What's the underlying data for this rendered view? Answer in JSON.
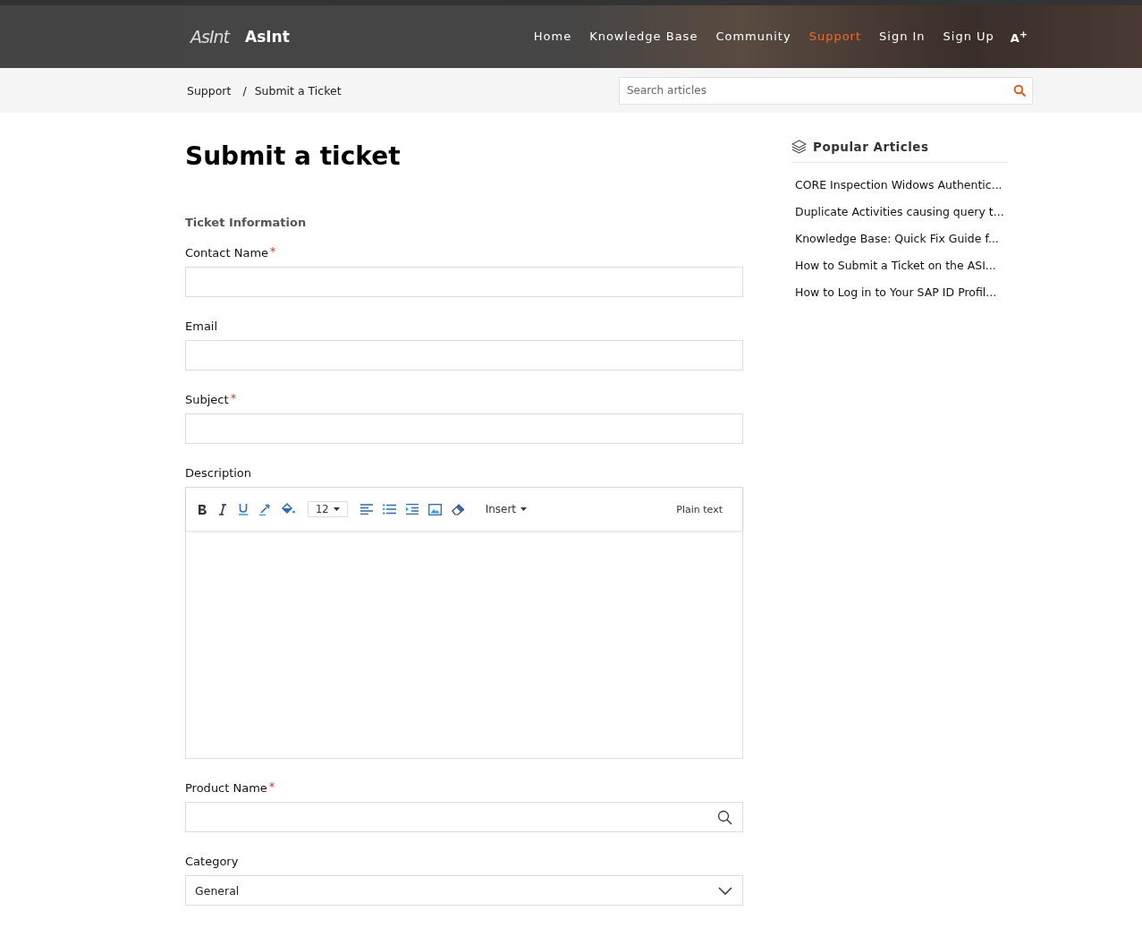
{
  "header": {
    "logo_mark": "AsInt",
    "brand": "AsInt",
    "nav": [
      {
        "label": "Home",
        "selected": false
      },
      {
        "label": "Knowledge Base",
        "selected": false
      },
      {
        "label": "Community",
        "selected": false
      },
      {
        "label": "Support",
        "selected": true
      },
      {
        "label": "Sign In",
        "selected": false
      },
      {
        "label": "Sign Up",
        "selected": false
      }
    ],
    "text_size_button": "A$^{+}$"
  },
  "breadcrumb": [
    "Support",
    "Submit a Ticket"
  ],
  "breadcrumb_separator": "/",
  "search": {
    "placeholder": "Search articles"
  },
  "page_title": "Submit a ticket",
  "section_title": "Ticket Information",
  "fields": [
    {
      "kind": "text",
      "label": "Contact Name",
      "required": true
    },
    {
      "kind": "text",
      "label": "Email",
      "required": false
    },
    {
      "kind": "text",
      "label": "Subject",
      "required": true
    },
    {
      "kind": "editor",
      "label": "Description",
      "required": false
    },
    {
      "kind": "lookup",
      "label": "Product Name",
      "required": true
    },
    {
      "kind": "select",
      "label": "Category",
      "required": false,
      "value": "General"
    }
  ],
  "editor_toolbar": {
    "font_size": "12",
    "insert": "Insert",
    "mode": "Plain text"
  },
  "popular_articles": {
    "title": "Popular Articles",
    "items": [
      "CORE Inspection Widows Authentic...",
      "Duplicate Activities causing query t...",
      "Knowledge Base: Quick Fix Guide f...",
      "How to Submit a Ticket on the ASI...",
      "How to Log in to Your SAP ID Profil..."
    ]
  }
}
